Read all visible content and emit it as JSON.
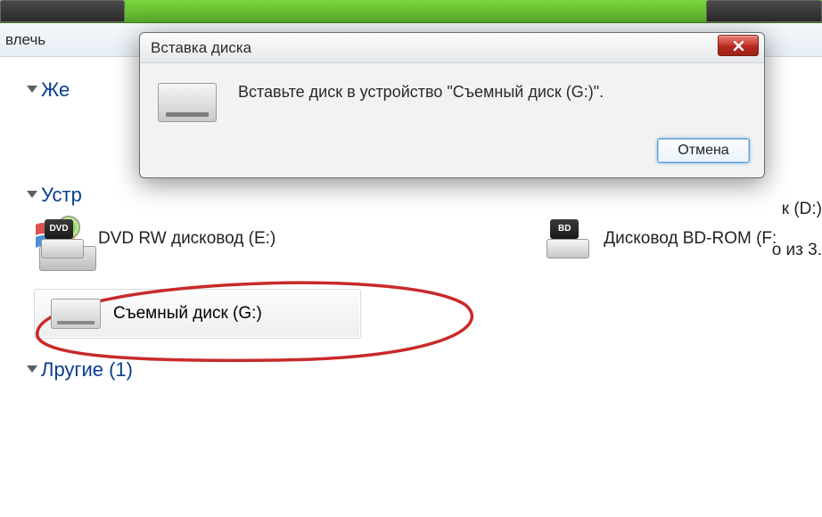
{
  "toolbar": {
    "extract_label": "влечь"
  },
  "sections": {
    "hard_drives_partial": "Же",
    "devices_partial": "Устр",
    "other_partial": "Лругие (1)"
  },
  "drives": {
    "dvd": {
      "label": "DVD RW дисковод (E:)",
      "badge": "DVD"
    },
    "bd": {
      "label": "Дисковод BD-ROM (F:",
      "badge": "BD"
    },
    "removable": {
      "label": "Съемный диск (G:)"
    }
  },
  "side_text": {
    "disk_d": "к (D:)",
    "free_partial": "о из 3."
  },
  "dialog": {
    "title": "Вставка диска",
    "message": "Вставьте диск в устройство \"Съемный диск (G:)\".",
    "cancel": "Отмена",
    "close_name": "close"
  }
}
